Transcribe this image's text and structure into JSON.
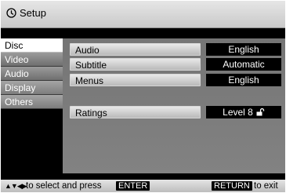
{
  "window": {
    "title": "Setup",
    "icon": "setup-icon"
  },
  "sidebar": {
    "items": [
      {
        "label": "Disc",
        "state": "selected"
      },
      {
        "label": "Video",
        "state": "normal"
      },
      {
        "label": "Audio",
        "state": "normal"
      },
      {
        "label": "Display",
        "state": "normal"
      },
      {
        "label": "Others",
        "state": "normal"
      }
    ]
  },
  "settings": [
    {
      "label": "Audio",
      "value": "English"
    },
    {
      "label": "Subtitle",
      "value": "Automatic"
    },
    {
      "label": "Menus",
      "value": "English"
    },
    {
      "label": "Ratings",
      "value": "Level 8",
      "icon": "unlocked-padlock-icon"
    }
  ],
  "footer": {
    "nav_arrows": "▲▼◀▶",
    "hint_text": "to select and press",
    "enter_key": "ENTER",
    "return_key": "RETURN",
    "exit_text": "to exit"
  },
  "colors": {
    "background": "#000000",
    "value_box": "#000000",
    "selected_tab": "#ffffff",
    "panel": "#7b7b7b"
  }
}
